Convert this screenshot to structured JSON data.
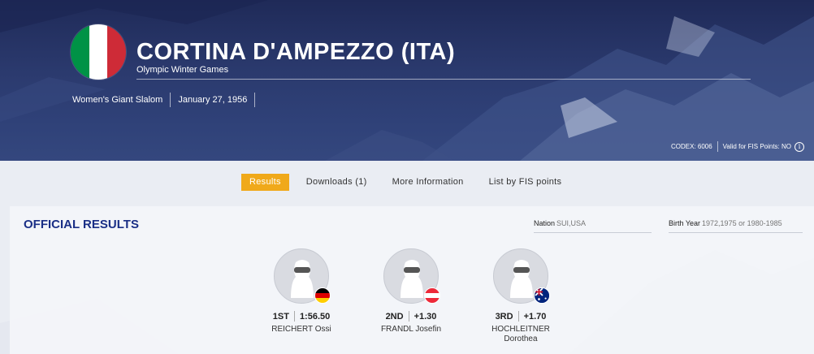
{
  "header": {
    "title": "CORTINA D'AMPEZZO (ITA)",
    "subtitle": "Olympic Winter Games",
    "flag_colors": [
      "#009246",
      "#ffffff",
      "#ce2b37"
    ],
    "event": "Women's Giant Slalom",
    "date": "January 27, 1956",
    "codex": "CODEX: 6006",
    "fis_points": "Valid for FIS Points: NO",
    "info_icon": "i"
  },
  "tabs": [
    {
      "label": "Results",
      "active": true
    },
    {
      "label": "Downloads (1)",
      "active": false
    },
    {
      "label": "More Information",
      "active": false
    },
    {
      "label": "List by FIS points",
      "active": false
    }
  ],
  "results": {
    "title": "OFFICIAL RESULTS",
    "nation_label": "Nation",
    "nation_placeholder": "SUI,USA",
    "birth_label": "Birth Year",
    "birth_placeholder": "1972,1975 or 1980-1985"
  },
  "podium": [
    {
      "rank": "1ST",
      "time": "1:56.50",
      "name": "REICHERT Ossi",
      "flag": "germany-flag-icon"
    },
    {
      "rank": "2ND",
      "time": "+1.30",
      "name": "FRANDL Josefin",
      "flag": "austria-flag-icon"
    },
    {
      "rank": "3RD",
      "time": "+1.70",
      "name": "HOCHLEITNER Dorothea",
      "flag": "australia-flag-icon"
    }
  ],
  "colors": {
    "accent": "#f0a91a",
    "heading": "#1a2f86",
    "hero": "#2b3a6e"
  }
}
